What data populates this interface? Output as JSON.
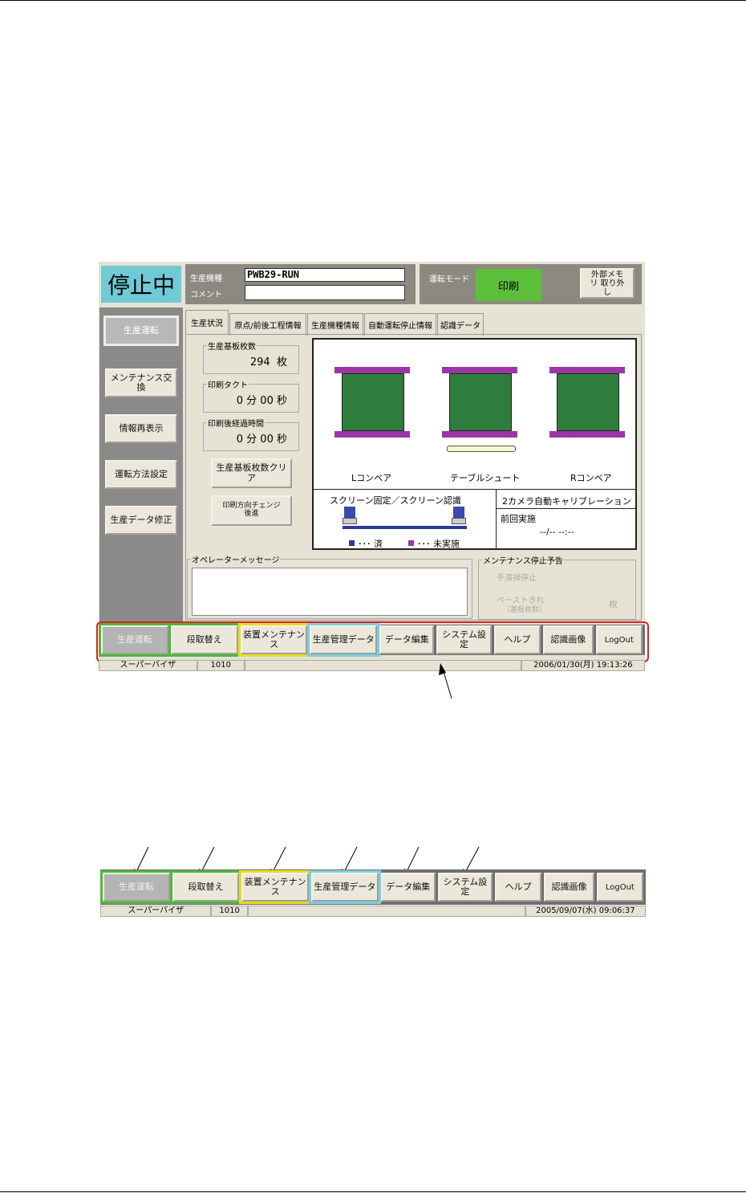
{
  "status": "停止中",
  "model_label": "生産機種",
  "model_value": "PWB29-RUN",
  "comment_label": "コメント",
  "comment_value": "",
  "mode_label": "運転モード",
  "mode_value": "印刷",
  "eject_button": "外部メモリ 取り外し",
  "sidebar": [
    "生産運転",
    "メンテナンス交換",
    "情報再表示",
    "運転方法設定",
    "生産データ修正"
  ],
  "tabs": [
    "生産状況",
    "原点/前後工程情報",
    "生産機種情報",
    "自動運転停止情報",
    "認識データ"
  ],
  "count": {
    "label": "生産基板枚数",
    "value": "294",
    "unit": "枚"
  },
  "tact": {
    "label": "印刷タクト",
    "min": "0",
    "min_unit": "分",
    "sec": "00",
    "sec_unit": "秒"
  },
  "elapsed": {
    "label": "印刷後経過時間",
    "min": "0",
    "min_unit": "分",
    "sec": "00",
    "sec_unit": "秒"
  },
  "clear_button": "生産基板枚数クリア",
  "dir_button": "印刷方向チェンジ 後進",
  "conveyors": [
    "Lコンベア",
    "テーブルシュート",
    "Rコンベア"
  ],
  "screen_title": "スクリーン固定／スクリーン認識",
  "legend_done": "･･･ 済",
  "legend_todo": "･･･ 未実施",
  "calib_title": "2カメラ自動キャリブレーション",
  "calib_prev": "前回実施",
  "calib_value": "--/-- --:--",
  "operator_msg_label": "オペレーターメッセージ",
  "maint": {
    "label": "メンテナンス停止予告",
    "item1": "手清掃停止",
    "item2": "ペーストきれ",
    "item2_sub": "（基板枚数）",
    "unit": "枚"
  },
  "toolbar": [
    "生産運転",
    "段取替え",
    "装置メンテナンス",
    "生産管理データ",
    "データ編集",
    "システム設定",
    "ヘルプ",
    "認識画像",
    "LogOut"
  ],
  "status_bar1": {
    "user": "スーパーバイザ",
    "code": "1010",
    "datetime": "2006/01/30(月) 19:13:26"
  },
  "status_bar2": {
    "user": "スーパーバイザ",
    "code": "1010",
    "datetime": "2005/09/07(水) 09:06:37"
  },
  "colors": {
    "status": "#6fcad6",
    "mode": "#5cc03a",
    "green": "#4cb83a",
    "yellow": "#e8dc20",
    "cyan": "#7ccfe0",
    "highlight": "#e02020"
  }
}
